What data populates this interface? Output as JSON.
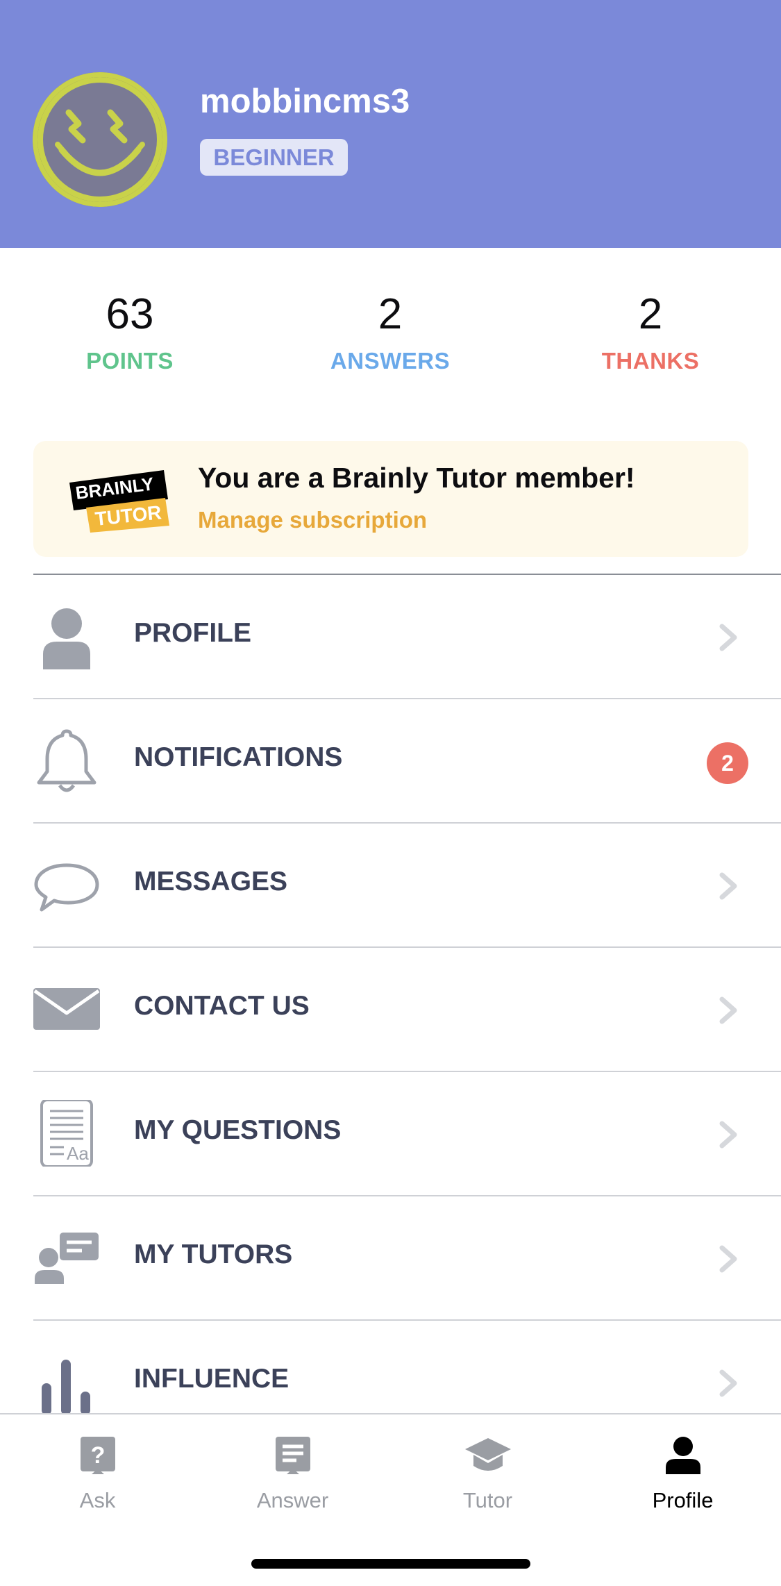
{
  "header": {
    "username": "mobbincms3",
    "rank": "BEGINNER",
    "avatar_icon": "smiley-lightning-avatar",
    "background_color": "#7b89d9"
  },
  "stats": [
    {
      "value": "63",
      "label": "POINTS",
      "color": "#5fc48c"
    },
    {
      "value": "2",
      "label": "ANSWERS",
      "color": "#6aa9ea"
    },
    {
      "value": "2",
      "label": "THANKS",
      "color": "#ec7065"
    }
  ],
  "tutor_card": {
    "logo_line1": "BRAINLY",
    "logo_line2": "TUTOR",
    "title": "You are a Brainly Tutor member!",
    "link": "Manage subscription"
  },
  "menu": {
    "items": [
      {
        "label": "PROFILE",
        "icon": "person-icon"
      },
      {
        "label": "NOTIFICATIONS",
        "icon": "bell-icon",
        "badge": "2"
      },
      {
        "label": "MESSAGES",
        "icon": "speech-bubble-icon"
      },
      {
        "label": "CONTACT US",
        "icon": "envelope-icon"
      },
      {
        "label": "MY QUESTIONS",
        "icon": "document-icon"
      },
      {
        "label": "MY TUTORS",
        "icon": "tutor-board-icon"
      },
      {
        "label": "INFLUENCE",
        "icon": "bar-chart-icon"
      }
    ]
  },
  "tabbar": {
    "tabs": [
      {
        "label": "Ask",
        "icon": "question-icon",
        "active": false
      },
      {
        "label": "Answer",
        "icon": "answer-icon",
        "active": false
      },
      {
        "label": "Tutor",
        "icon": "graduation-cap-icon",
        "active": false
      },
      {
        "label": "Profile",
        "icon": "person-icon",
        "active": true
      }
    ]
  }
}
